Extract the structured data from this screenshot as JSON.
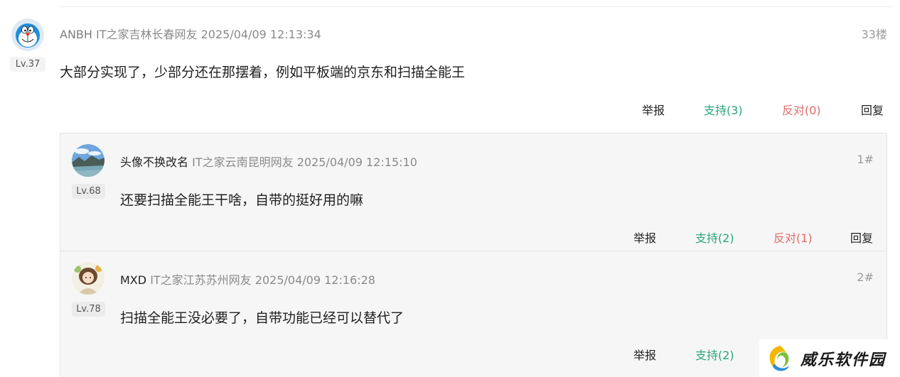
{
  "main_comment": {
    "username": "ANBH",
    "location": "IT之家吉林长春网友",
    "timestamp": "2025/04/09 12:13:34",
    "floor": "33楼",
    "level": "Lv.37",
    "text": "大部分实现了，少部分还在那摆着，例如平板端的京东和扫描全能王",
    "actions": {
      "report": "举报",
      "support": "支持(3)",
      "oppose": "反对(0)",
      "reply": "回复"
    }
  },
  "replies": [
    {
      "username": "头像不换改名",
      "location": "IT之家云南昆明网友",
      "timestamp": "2025/04/09 12:15:10",
      "floor": "1#",
      "level": "Lv.68",
      "text": "还要扫描全能王干啥，自带的挺好用的嘛",
      "actions": {
        "report": "举报",
        "support": "支持(2)",
        "oppose": "反对(1)",
        "reply": "回复"
      }
    },
    {
      "username": "MXD",
      "location": "IT之家江苏苏州网友",
      "timestamp": "2025/04/09 12:16:28",
      "floor": "2#",
      "level": "Lv.78",
      "text": "扫描全能王没必要了，自带功能已经可以替代了",
      "actions": {
        "report": "举报",
        "support": "支持(2)"
      }
    }
  ],
  "watermark": {
    "text": "威乐软件园"
  },
  "colors": {
    "support": "#2aa57a",
    "oppose": "#e06a6a",
    "meta": "#8a8a8a"
  },
  "icons": {
    "main_avatar": "doraemon-avatar-icon",
    "reply1_avatar": "landscape-avatar-icon",
    "reply2_avatar": "girl-avatar-icon",
    "watermark_logo": "swirl-logo-icon"
  }
}
